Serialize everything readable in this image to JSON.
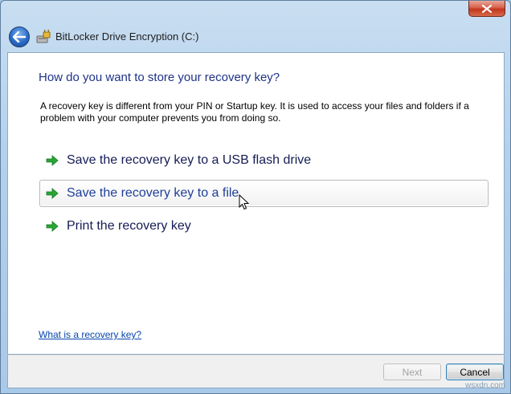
{
  "window": {
    "title": "BitLocker Drive Encryption (C:)",
    "close_symbol": "✕"
  },
  "main": {
    "heading": "How do you want to store your recovery key?",
    "description": "A recovery key is different from your PIN or Startup key. It is used to access your files and folders if a problem with your computer prevents you from doing so.",
    "options": [
      {
        "label": "Save the recovery key to a USB flash drive"
      },
      {
        "label": "Save the recovery key to a file"
      },
      {
        "label": "Print the recovery key"
      }
    ],
    "help_link": "What is a recovery key?"
  },
  "footer": {
    "next_label": "Next",
    "cancel_label": "Cancel"
  },
  "watermark": "wsxdn.com",
  "colors": {
    "heading": "#1e3287",
    "link": "#0645ad",
    "arrow_green": "#2aa536",
    "close_red": "#c2361d"
  },
  "icons": {
    "back": "back-arrow-icon",
    "app": "bitlocker-icon",
    "option_arrow": "green-arrow-icon",
    "close": "close-icon"
  }
}
